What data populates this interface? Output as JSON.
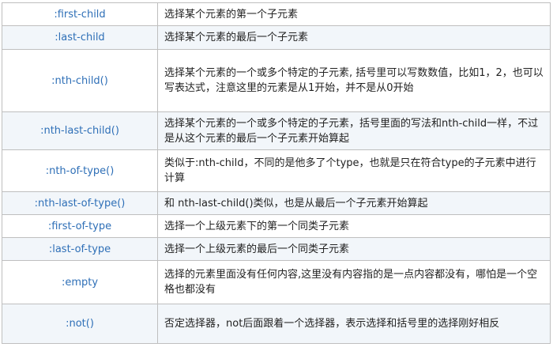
{
  "rows": [
    {
      "selector": ":first-child",
      "description": "选择某个元素的第一个子元素"
    },
    {
      "selector": ":last-child",
      "description": "选择某个元素的最后一个子元素"
    },
    {
      "selector": ":nth-child()",
      "description": "选择某个元素的一个或多个特定的子元素, 括号里可以写数数值，比如1，2，也可以写表达式，注意这里的元素是从1开始，并不是从0开始"
    },
    {
      "selector": ":nth-last-child()",
      "description": "选择某个元素的一个或多个特定的子元素，括号里面的写法和nth-child一样，不过是从这个元素的最后一个子元素开始算起"
    },
    {
      "selector": ":nth-of-type()",
      "description": "类似于:nth-child，不同的是他多了个type，也就是只在符合type的子元素中进行计算"
    },
    {
      "selector": ":nth-last-of-type()",
      "description": "和 nth-last-child()类似，也是从最后一个子元素开始算起"
    },
    {
      "selector": ":first-of-type",
      "description": "选择一个上级元素下的第一个同类子元素"
    },
    {
      "selector": ":last-of-type",
      "description": "选择一个上级元素的最后一个同类子元素"
    },
    {
      "selector": ":empty",
      "description": "选择的元素里面没有任何内容,这里没有内容指的是一点内容都没有，哪怕是一个空格也都没有"
    },
    {
      "selector": ":not()",
      "description": "否定选择器，not后面跟着一个选择器，表示选择和括号里的选择刚好相反"
    }
  ]
}
